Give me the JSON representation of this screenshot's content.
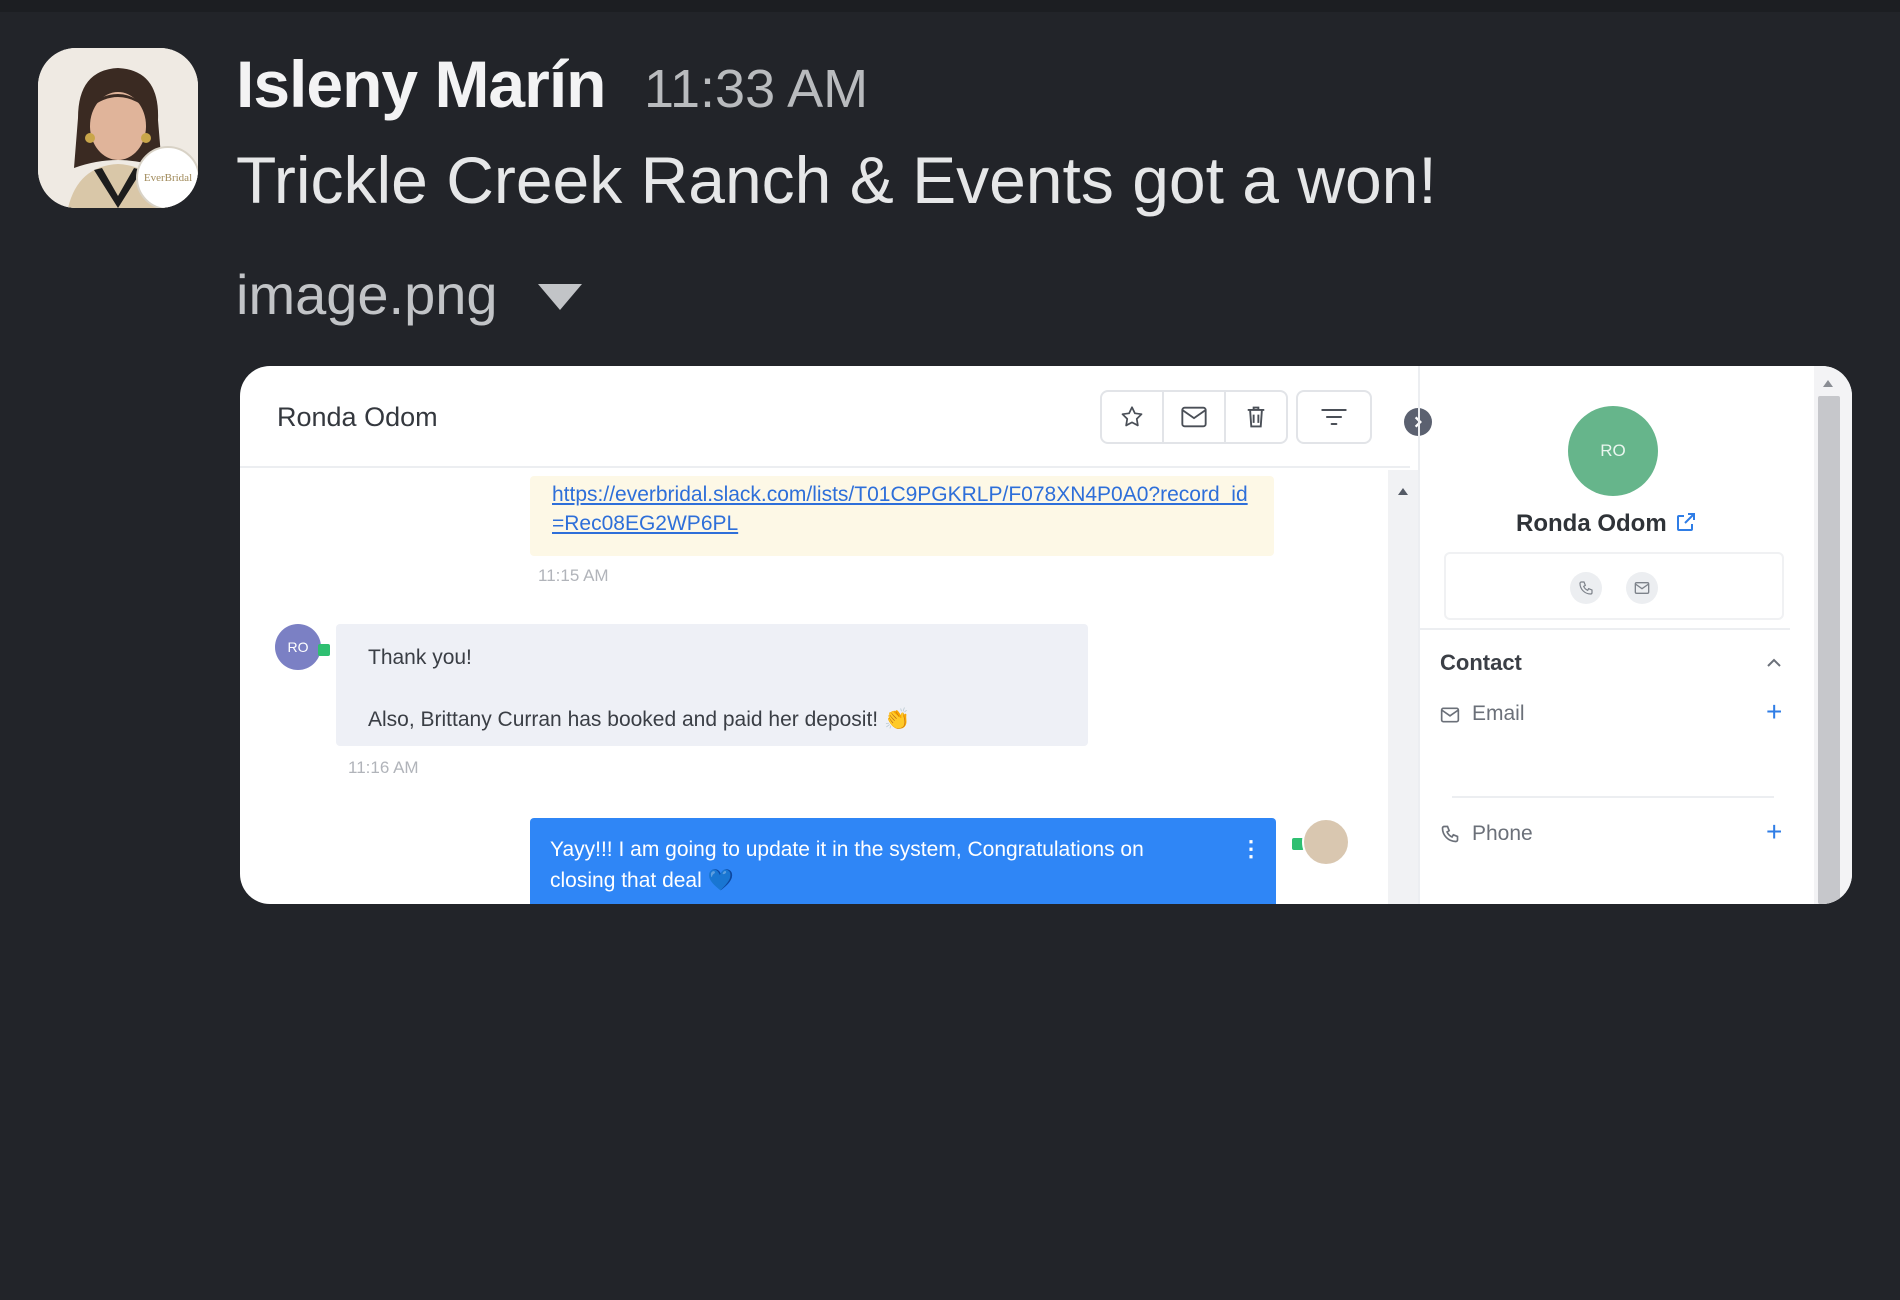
{
  "message": {
    "sender": "Isleny Marín",
    "time": "11:33 AM",
    "text": "Trickle Creek Ranch & Events got a won!",
    "attachment_name": "image.png",
    "avatar_badge_text": "EverBridal"
  },
  "screenshot": {
    "header": {
      "contact_name": "Ronda Odom"
    },
    "toolbar_icons": [
      "star-icon",
      "mail-icon",
      "trash-icon",
      "filter-icon"
    ],
    "messages": [
      {
        "direction": "outgoing",
        "link": "https://everbridal.slack.com/lists/T01C9PGKRLP/F078XN4P0A0?record_id=Rec08EG2WP6PL",
        "time": "11:15 AM"
      },
      {
        "direction": "incoming",
        "avatar": "RO",
        "line1": "Thank you!",
        "line2": "Also, Brittany Curran has booked and paid her deposit! 👏",
        "time": "11:16 AM"
      },
      {
        "direction": "outgoing",
        "text": "Yayy!!! I am going to update it in the system, Congratulations on closing that deal 💙"
      }
    ],
    "sidebar": {
      "avatar": "RO",
      "name": "Ronda Odom",
      "section_title": "Contact",
      "fields": [
        {
          "label": "Email",
          "icon": "mail-icon"
        },
        {
          "label": "Phone",
          "icon": "phone-icon"
        }
      ]
    },
    "colors": {
      "outgoing_bubble": "#2f86f6",
      "link_bubble": "#fdf8e6",
      "incoming_bubble": "#eef0f6",
      "contact_avatar": "#66b58b",
      "incoming_avatar": "#7b80c4"
    }
  }
}
